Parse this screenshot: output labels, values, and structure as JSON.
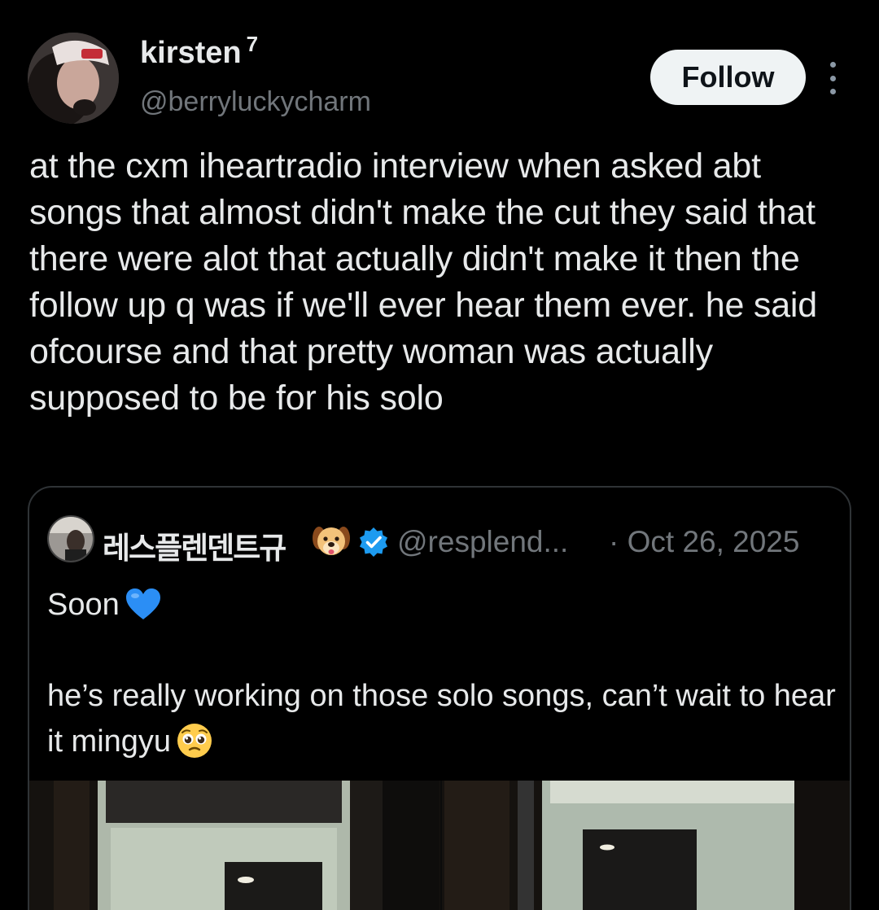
{
  "author": {
    "display_name": "kirsten",
    "name_suffix": "7",
    "handle": "@berryluckycharm"
  },
  "follow_label": "Follow",
  "post_text": "at the cxm iheartradio interview when asked abt songs that almost didn't make the cut they said that there were alot that actually didn't make it then the follow up q was if we'll ever hear them ever. he said ofcourse and that pretty woman was actually supposed to be for his solo",
  "quote": {
    "display_name": "레스플렌덴트규",
    "handle": "@resplend...",
    "date": "· Oct 26, 2025",
    "text_line1": "Soon",
    "text_line2": "he’s really working on those solo songs, can’t wait to hear it mingyu",
    "icons": [
      "dog-face-emoji",
      "verified-badge",
      "blue-heart-emoji",
      "pleading-face-emoji"
    ],
    "colors": {
      "verified": "#1d9bf0",
      "heart": "#2b8ef5"
    }
  }
}
